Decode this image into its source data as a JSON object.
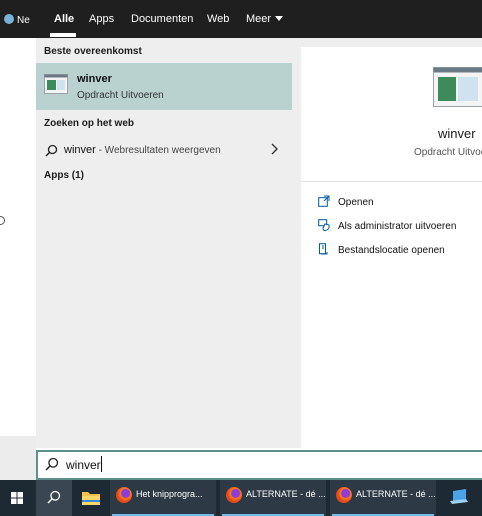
{
  "background": {
    "taskbar_item_fragment": "Ne"
  },
  "filter_tabs": [
    {
      "label": "Alle",
      "active": true
    },
    {
      "label": "Apps",
      "active": false
    },
    {
      "label": "Documenten",
      "active": false
    },
    {
      "label": "Web",
      "active": false
    },
    {
      "label": "Meer",
      "active": false,
      "has_dropdown": true
    }
  ],
  "results": {
    "best_match_header": "Beste overeenkomst",
    "best_match": {
      "title": "winver",
      "subtitle": "Opdracht Uitvoeren",
      "icon": "app-window-icon"
    },
    "web_header": "Zoeken op het web",
    "web_result": {
      "query": "winver",
      "hint": " - Webresultaten weergeven",
      "icon": "search-icon",
      "chevron": "chevron-right-icon"
    },
    "apps_header": "Apps (1)"
  },
  "preview": {
    "title": "winver",
    "subtitle": "Opdracht Uitvoe",
    "actions": [
      {
        "label": "Openen",
        "icon": "open-icon"
      },
      {
        "label": "Als administrator uitvoeren",
        "icon": "admin-shield-icon"
      },
      {
        "label": "Bestandslocatie openen",
        "icon": "file-location-icon"
      }
    ]
  },
  "search": {
    "query": "winver",
    "icon": "search-icon"
  },
  "taskbar": {
    "apps": [
      {
        "label": "Het knipprogra...",
        "icon": "firefox-icon"
      },
      {
        "label": "ALTERNATE - dé ...",
        "icon": "firefox-icon"
      },
      {
        "label": "ALTERNATE - dé ...",
        "icon": "firefox-icon"
      }
    ],
    "accent_color": "#76b9ed",
    "background_color": "#1e2a33"
  },
  "colors": {
    "highlight": "#b9d2d0",
    "search_border": "#5f8f8c",
    "topbar": "#1f1f1f"
  }
}
